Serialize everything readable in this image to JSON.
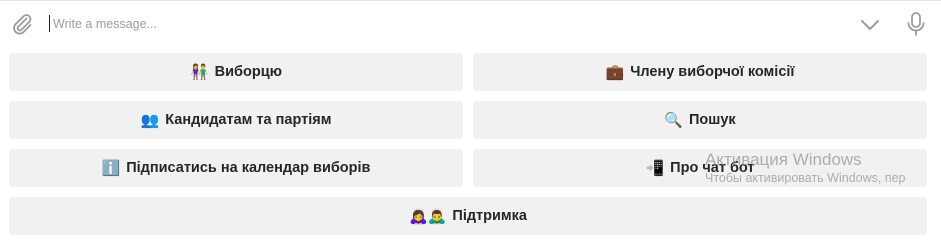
{
  "composer": {
    "placeholder": "Write a message..."
  },
  "keyboard": {
    "buttons": [
      {
        "emoji": "👫",
        "label": "Виборцю"
      },
      {
        "emoji": "💼",
        "label": "Члену виборчої комісії"
      },
      {
        "emoji": "👥",
        "label": "Кандидатам та партіям"
      },
      {
        "emoji": "🔍",
        "label": "Пошук"
      },
      {
        "emoji": "ℹ️",
        "label": "Підписатись на календар виборів"
      },
      {
        "emoji": "📲",
        "label": "Про чат бот"
      },
      {
        "emoji": "🙇‍♀️🙇‍♂️",
        "label": "Підтримка"
      }
    ]
  },
  "watermark": {
    "title": "Активация Windows",
    "subtitle": "Чтобы активировать Windows, пер"
  },
  "colors": {
    "button_bg": "#f1f1f1",
    "button_text": "#262626",
    "icon_gray": "#9c9c9c",
    "placeholder": "#9d9d9d"
  }
}
